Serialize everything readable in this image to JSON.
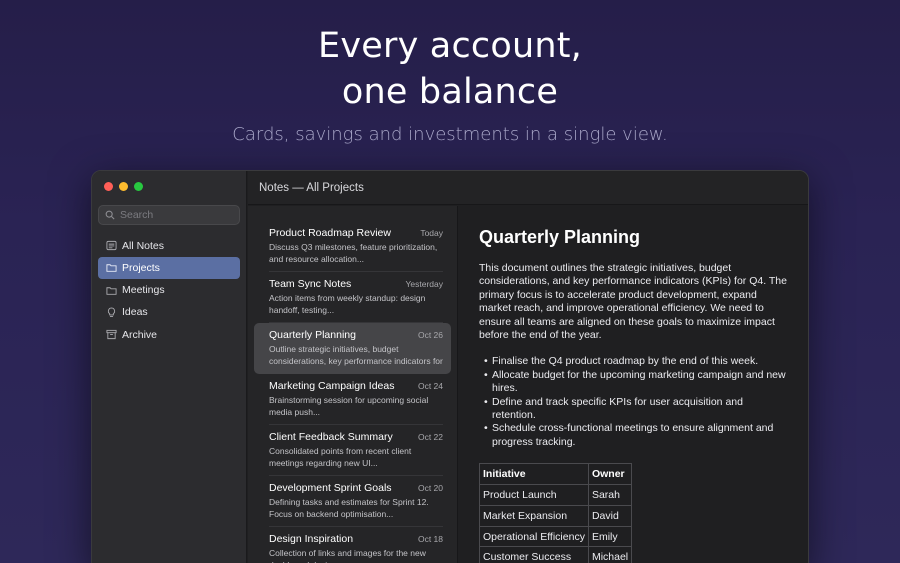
{
  "hero": {
    "title_line1": "Every account,",
    "title_line2": "one balance",
    "subtitle": "Cards, savings and investments in a single view."
  },
  "window": {
    "title": "Notes — All Projects",
    "search": {
      "placeholder": "Search"
    },
    "sidebar": {
      "items": [
        {
          "label": "All Notes",
          "icon": "list-icon",
          "active": false
        },
        {
          "label": "Projects",
          "icon": "folder-icon",
          "active": true
        },
        {
          "label": "Meetings",
          "icon": "folder-icon",
          "active": false
        },
        {
          "label": "Ideas",
          "icon": "lightbulb-icon",
          "active": false
        },
        {
          "label": "Archive",
          "icon": "archive-icon",
          "active": false
        }
      ]
    },
    "notes": [
      {
        "title": "Product Roadmap Review",
        "date": "Today",
        "snippet": "Discuss Q3 milestones, feature prioritization, and resource allocation..."
      },
      {
        "title": "Team Sync Notes",
        "date": "Yesterday",
        "snippet": "Action items from weekly standup: design handoff, testing..."
      },
      {
        "title": "Quarterly Planning",
        "date": "Oct 26",
        "snippet": "Outline strategic initiatives, budget considerations, key performance indicators for"
      },
      {
        "title": "Marketing Campaign Ideas",
        "date": "Oct 24",
        "snippet": "Brainstorming session for upcoming social media push..."
      },
      {
        "title": "Client Feedback Summary",
        "date": "Oct 22",
        "snippet": "Consolidated points from recent client meetings regarding new UI..."
      },
      {
        "title": "Development Sprint Goals",
        "date": "Oct 20",
        "snippet": "Defining tasks and estimates for Sprint 12. Focus on backend optimisation..."
      },
      {
        "title": "Design Inspiration",
        "date": "Oct 18",
        "snippet": "Collection of links and images for the new dashboard design..."
      }
    ],
    "selected_note_index": 2,
    "document": {
      "title": "Quarterly Planning",
      "body": "This document outlines the strategic initiatives, budget considerations, and key performance indicators (KPIs) for Q4. The primary focus is to accelerate product development, expand market reach, and improve operational efficiency. We need to ensure all teams are aligned on these goals to maximize impact before the end of the year.",
      "bullets": [
        "Finalise the Q4 product roadmap by the end of this week.",
        "Allocate budget for the upcoming marketing campaign and new hires.",
        "Define and track specific KPIs for user acquisition and retention.",
        "Schedule cross-functional meetings to ensure alignment and progress tracking."
      ],
      "table": {
        "headers": [
          "Initiative",
          "Owner"
        ],
        "rows": [
          [
            "Product Launch",
            "Sarah"
          ],
          [
            "Market Expansion",
            "David"
          ],
          [
            "Operational Efficiency",
            "Emily"
          ],
          [
            "Customer Success",
            "Michael"
          ]
        ]
      }
    }
  },
  "colors": {
    "background": "#251e49",
    "sidebar_active": "#5b6fa3",
    "window_bg": "#1f1f21"
  }
}
